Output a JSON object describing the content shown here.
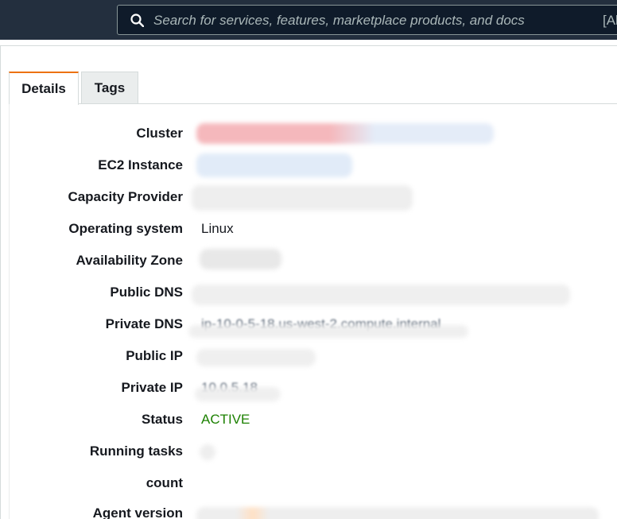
{
  "search": {
    "placeholder": "Search for services, features, marketplace products, and docs",
    "shortcut": "[Al"
  },
  "tabs": [
    {
      "label": "Details",
      "active": true
    },
    {
      "label": "Tags",
      "active": false
    }
  ],
  "details": {
    "cluster_label": "Cluster",
    "ec2_label": "EC2 Instance",
    "capacity_label": "Capacity Provider",
    "os_label": "Operating system",
    "os_value": "Linux",
    "az_label": "Availability Zone",
    "public_dns_label": "Public DNS",
    "private_dns_label": "Private DNS",
    "private_dns_value": "ip-10-0-5-18.us-west-2.compute.internal",
    "public_ip_label": "Public IP",
    "private_ip_label": "Private IP",
    "private_ip_value": "10.0.5.18",
    "status_label": "Status",
    "status_value": "ACTIVE",
    "running_tasks_label": "Running tasks",
    "count_label": "count",
    "agent_version_label": "Agent version"
  },
  "colors": {
    "topbar": "#232f3e",
    "status_active": "#1d8102",
    "tab_accent": "#ec7211"
  }
}
